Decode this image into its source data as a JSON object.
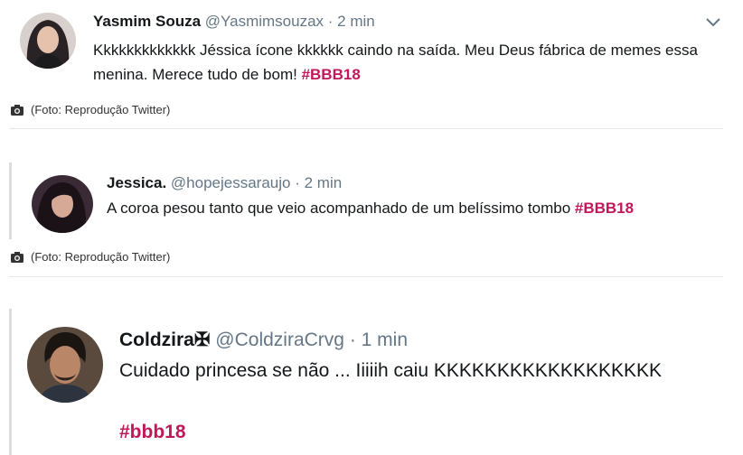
{
  "tweets": [
    {
      "name": "Yasmim Souza",
      "handle": "@Yasmimsouzax",
      "time": "· 2 min",
      "text": "Kkkkkkkkkkkkk Jéssica ícone kkkkkk caindo na saída. Meu Deus fábrica de memes essa menina. Merece tudo de bom! ",
      "hashtag": "#BBB18",
      "menu_icon": "chevron-down-icon",
      "caption": "(Foto: Reprodução Twitter)"
    },
    {
      "name": "Jessica.",
      "handle": "@hopejessaraujo",
      "time": "· 2 min",
      "text": "A coroa pesou tanto que veio acompanhado de um belíssimo tombo ",
      "hashtag": "#BBB18",
      "caption": "(Foto: Reprodução Twitter)"
    },
    {
      "name": "Coldzira✠",
      "handle": "@ColdziraCrvg",
      "time": "· 1 min",
      "text": "Cuidado princesa se não ... Iiiiih caiu KKKKKKKKKKKKKKKKKK",
      "hashtag": "#bbb18"
    }
  ],
  "colors": {
    "hashtag": "#c2185b",
    "handle": "#657786"
  }
}
